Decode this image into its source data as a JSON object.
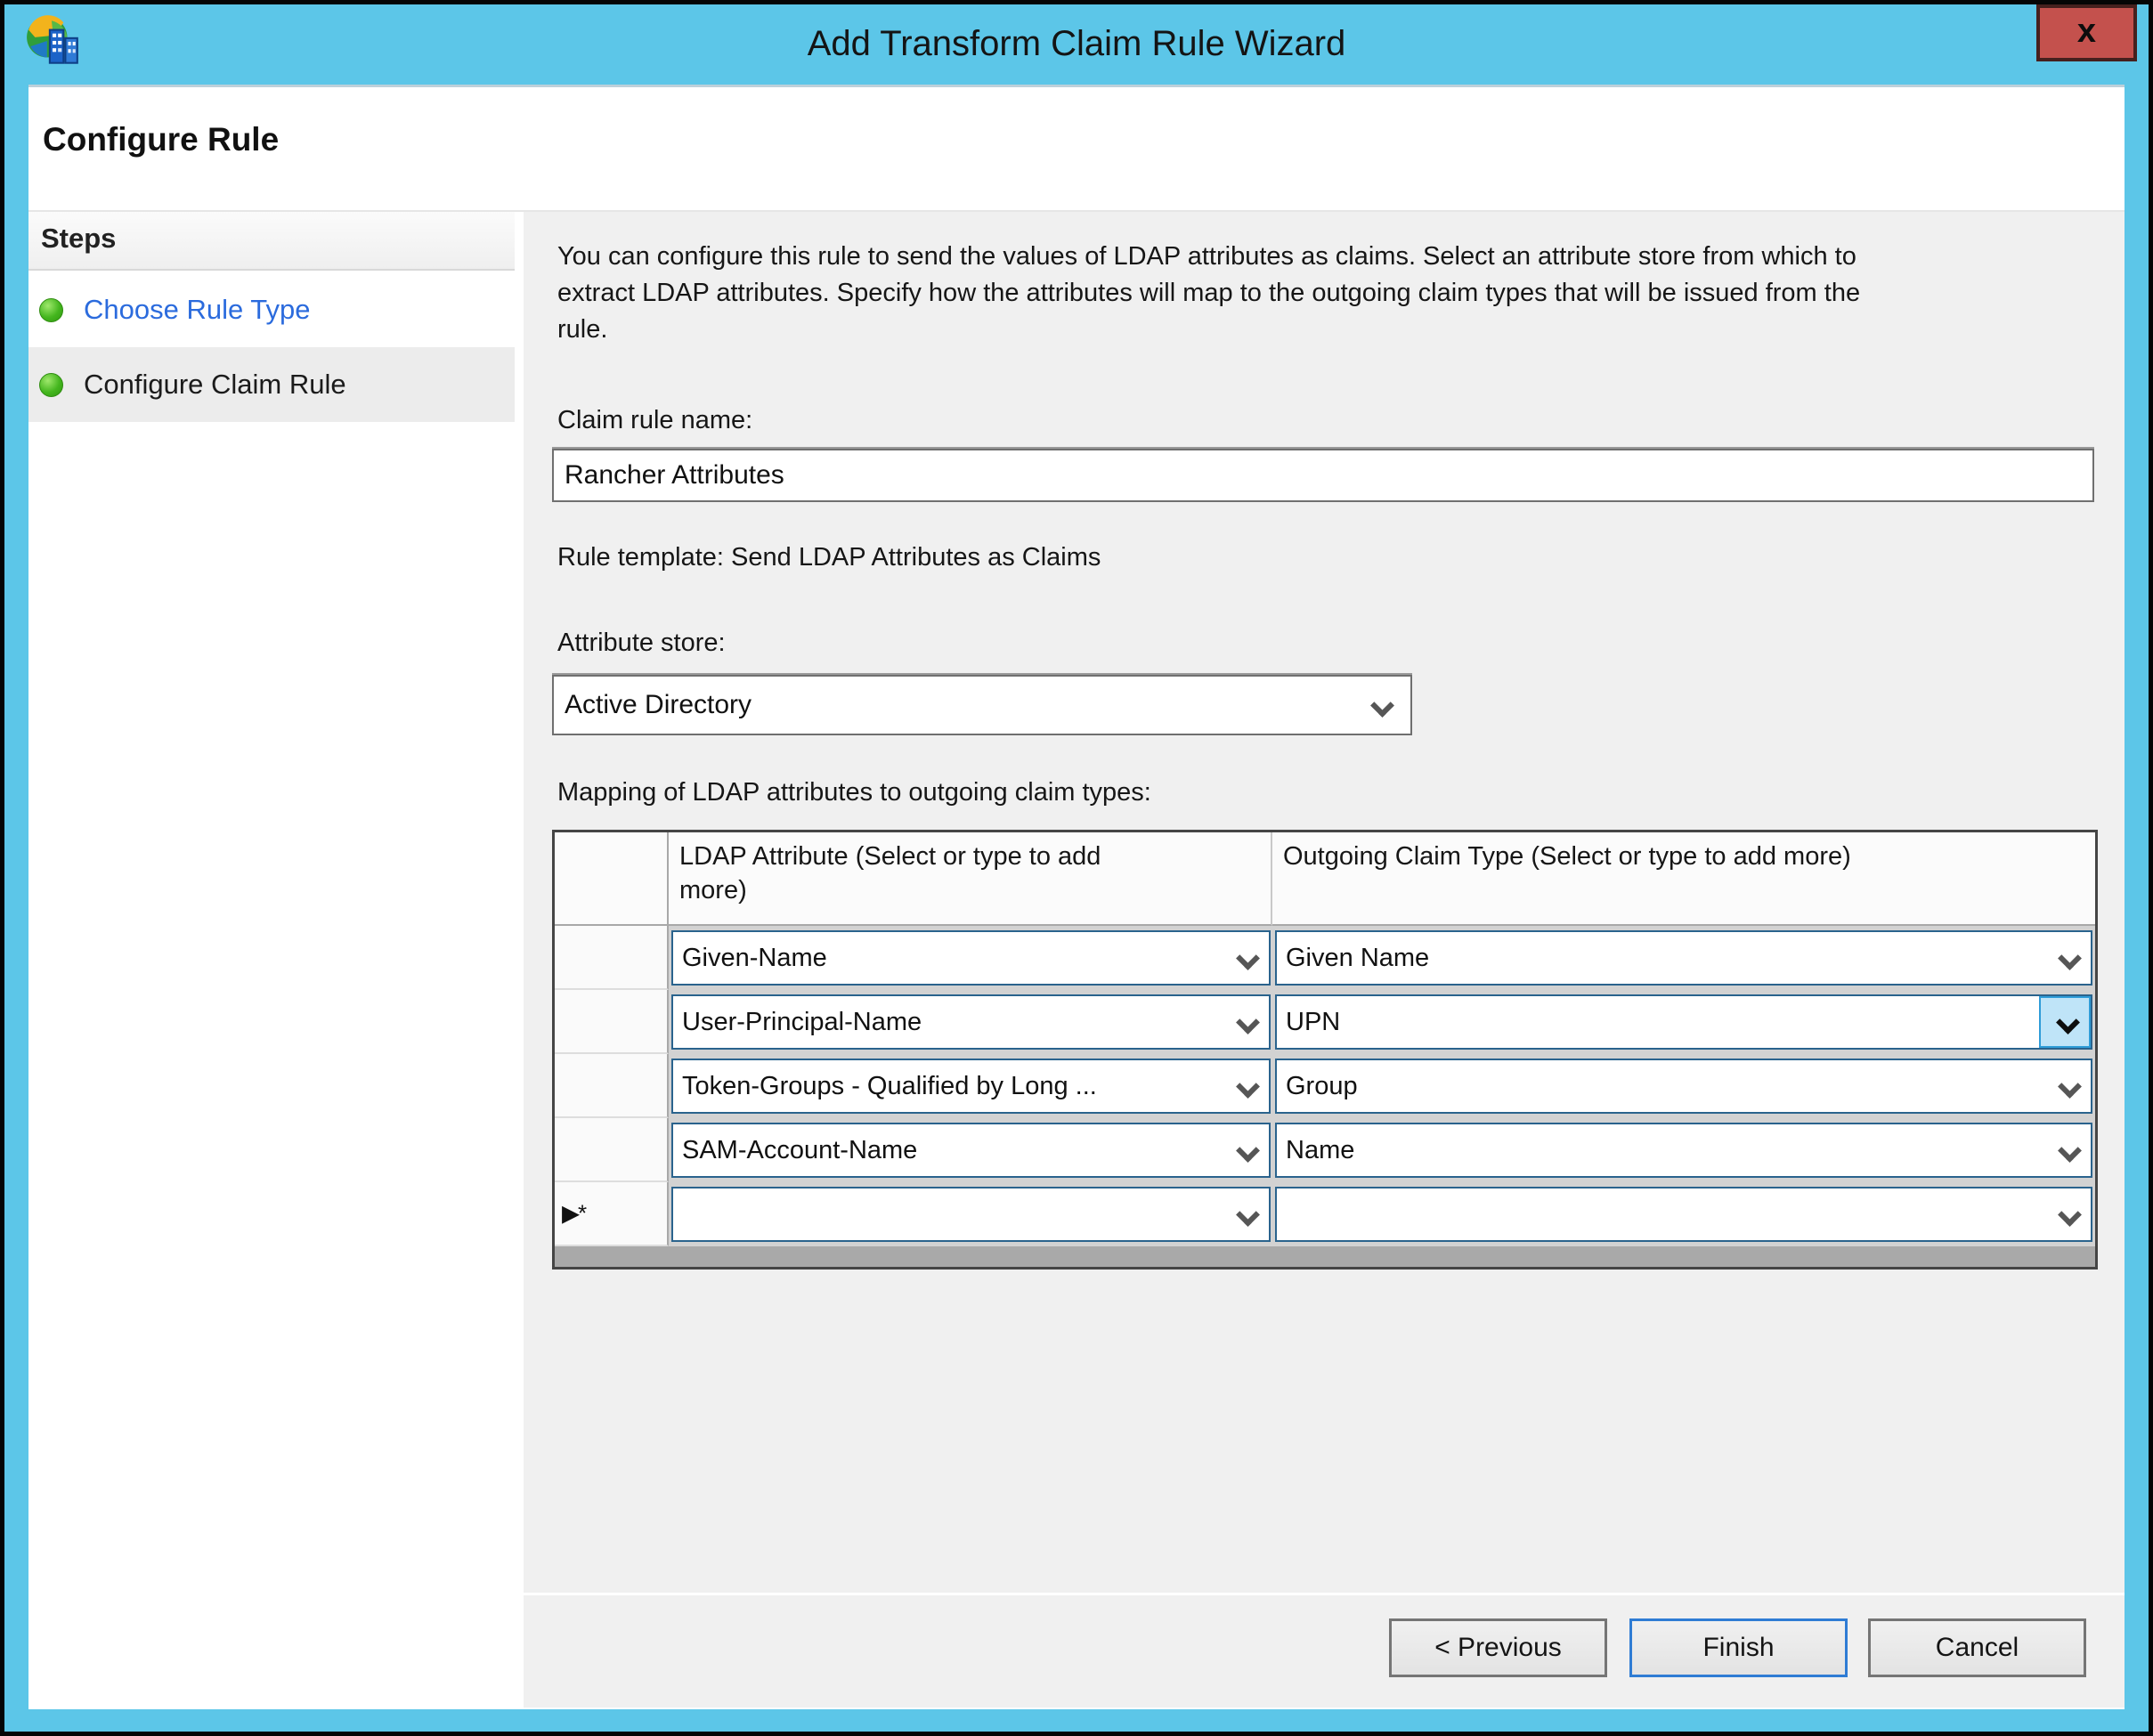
{
  "window": {
    "title": "Add Transform Claim Rule Wizard",
    "close_label": "x",
    "page_heading": "Configure Rule"
  },
  "steps_panel": {
    "header": "Steps",
    "items": [
      {
        "label": "Choose Rule Type",
        "state": "visited"
      },
      {
        "label": "Configure Claim Rule",
        "state": "current"
      }
    ]
  },
  "main": {
    "description": "You can configure this rule to send the values of LDAP attributes as claims. Select an attribute store from which to extract LDAP attributes. Specify how the attributes will map to the outgoing claim types that will be issued from the rule.",
    "claim_rule_name": {
      "label": "Claim rule name:",
      "value": "Rancher Attributes"
    },
    "rule_template": "Rule template: Send LDAP Attributes as Claims",
    "attribute_store": {
      "label": "Attribute store:",
      "value": "Active Directory"
    },
    "mapping_label": "Mapping of LDAP attributes to outgoing claim types:",
    "table": {
      "columns": [
        "LDAP Attribute (Select or type to add more)",
        "Outgoing Claim Type (Select or type to add more)"
      ],
      "rows": [
        {
          "ldap_attribute": "Given-Name",
          "outgoing_claim_type": "Given Name"
        },
        {
          "ldap_attribute": "User-Principal-Name",
          "outgoing_claim_type": "UPN",
          "active": true
        },
        {
          "ldap_attribute": "Token-Groups - Qualified by Long ...",
          "outgoing_claim_type": "Group"
        },
        {
          "ldap_attribute": "SAM-Account-Name",
          "outgoing_claim_type": "Name"
        },
        {
          "ldap_attribute": "",
          "outgoing_claim_type": "",
          "new_row_marker": "▶*"
        }
      ]
    }
  },
  "footer": {
    "buttons": [
      {
        "label": "< Previous"
      },
      {
        "label": "Finish",
        "default": true
      },
      {
        "label": "Cancel"
      }
    ]
  },
  "colors": {
    "titlebar": "#5CC6E8",
    "close_button": "#C4514D",
    "link_blue": "#2B6BDD",
    "step_bullet_green": "#44B61E",
    "combo_border": "#2A638D",
    "active_dropdown_highlight": "#BFE4F8",
    "active_dropdown_border": "#2E9CD8",
    "panel_gray": "#F0F0F0"
  }
}
